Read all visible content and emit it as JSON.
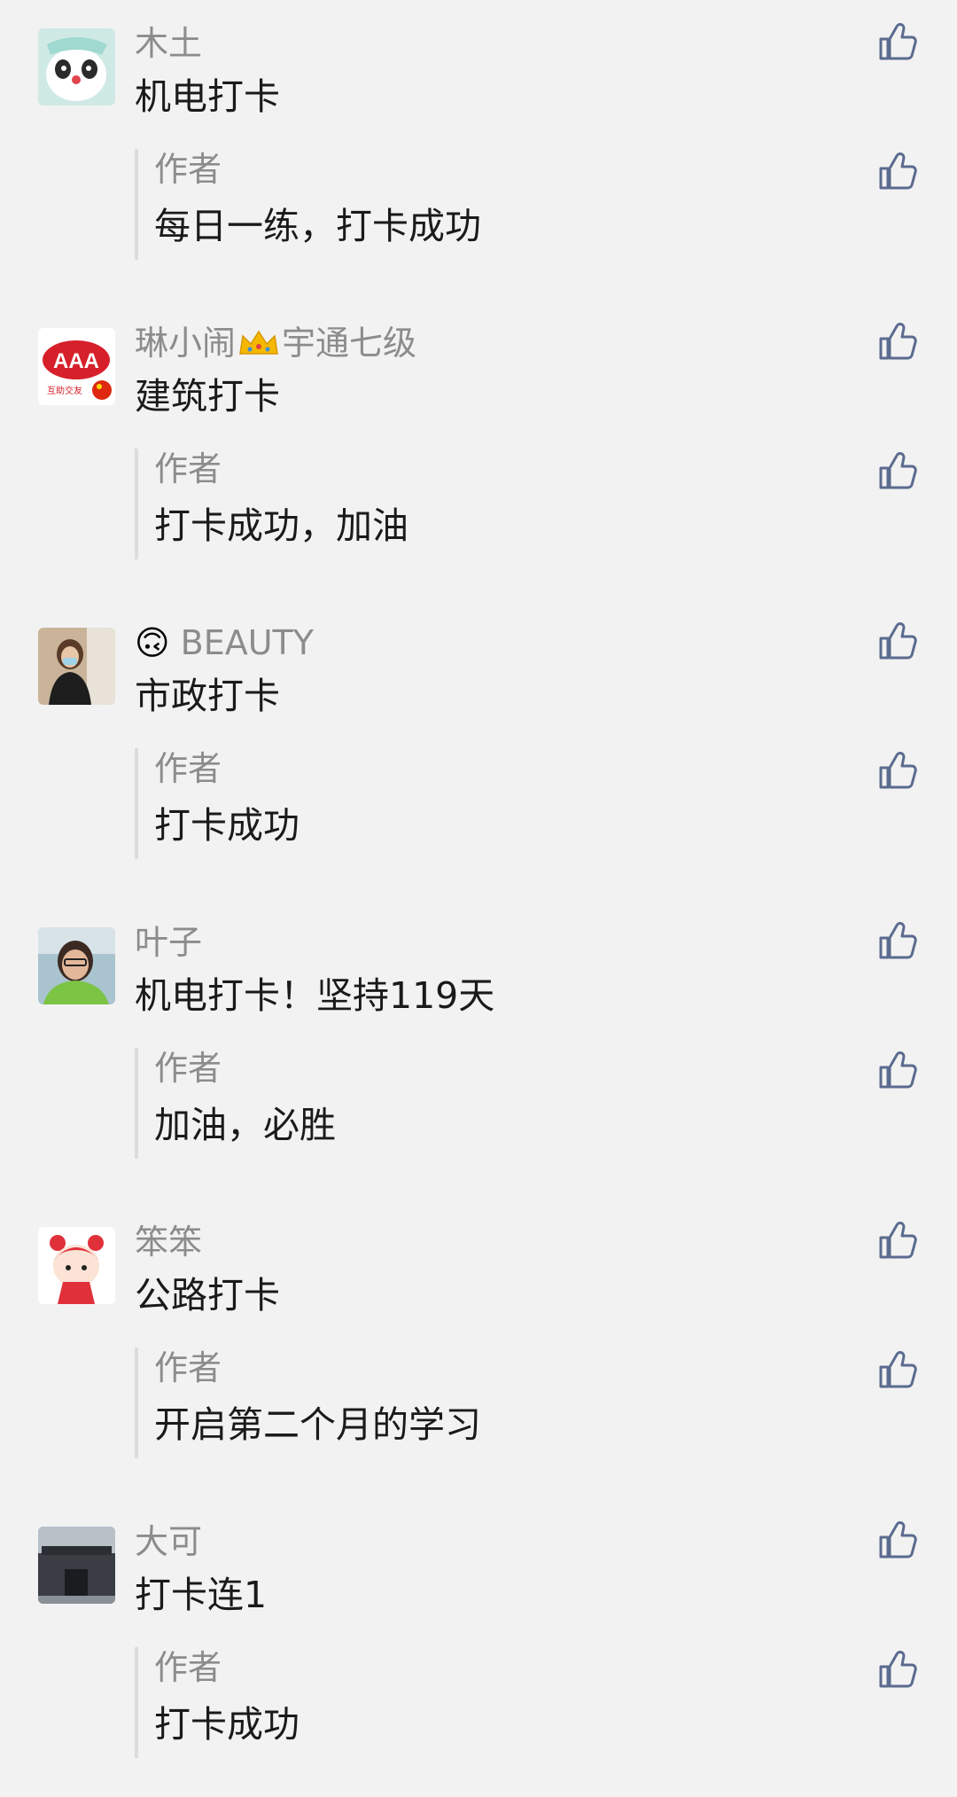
{
  "reply_author_label": "作者",
  "colors": {
    "background": "#f2f2f2",
    "nickname": "#8c8c8c",
    "text": "#1a1a1a",
    "like_icon": "#5b6b8f",
    "reply_bar": "#dcdcdc"
  },
  "comments": [
    {
      "nickname": "木土",
      "text": "机电打卡",
      "reply": "每日一练，打卡成功",
      "avatar_icon": "panda-avatar-icon"
    },
    {
      "nickname": "琳小闹",
      "name_suffix": "宇通七级",
      "name_icon": "crown-icon",
      "text": "建筑打卡",
      "reply": "打卡成功，加油",
      "avatar_icon": "aaa-logo-avatar-icon",
      "avatar_text": "AAA",
      "avatar_caption": "互助交友"
    },
    {
      "name_prefix": "🙃",
      "nickname": "BEAUTY",
      "text": "市政打卡",
      "reply": "打卡成功",
      "avatar_icon": "person-photo-avatar-icon"
    },
    {
      "nickname": "叶子",
      "text": "机电打卡！坚持119天",
      "reply": "加油，必胜",
      "avatar_icon": "selfie-avatar-icon"
    },
    {
      "nickname": "笨笨",
      "text": "公路打卡",
      "reply": "开启第二个月的学习",
      "avatar_icon": "cartoon-girl-avatar-icon"
    },
    {
      "nickname": "大可",
      "text": "打卡连1",
      "reply": "打卡成功",
      "avatar_icon": "building-photo-avatar-icon"
    }
  ]
}
